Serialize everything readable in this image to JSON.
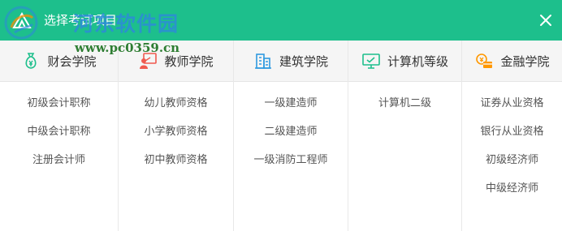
{
  "dialog": {
    "title": "选择考试项目",
    "close_icon": "close-icon"
  },
  "watermark": {
    "site_name": "河东软件园",
    "url": "www.pc0359.cn"
  },
  "colors": {
    "header": "#1dbf8c",
    "accent": "#ff9800"
  },
  "categories": [
    {
      "label": "财会学院",
      "icon": "money-bag-icon",
      "items": [
        "初级会计职称",
        "中级会计职称",
        "注册会计师"
      ]
    },
    {
      "label": "教师学院",
      "icon": "teacher-icon",
      "items": [
        "幼儿教师资格",
        "小学教师资格",
        "初中教师资格"
      ]
    },
    {
      "label": "建筑学院",
      "icon": "building-icon",
      "items": [
        "一级建造师",
        "二级建造师",
        "一级消防工程师"
      ]
    },
    {
      "label": "计算机等级",
      "icon": "monitor-icon",
      "items": [
        "计算机二级"
      ]
    },
    {
      "label": "金融学院",
      "icon": "coin-card-icon",
      "items": [
        "证券从业资格",
        "银行从业资格",
        "初级经济师",
        "中级经济师"
      ]
    }
  ]
}
